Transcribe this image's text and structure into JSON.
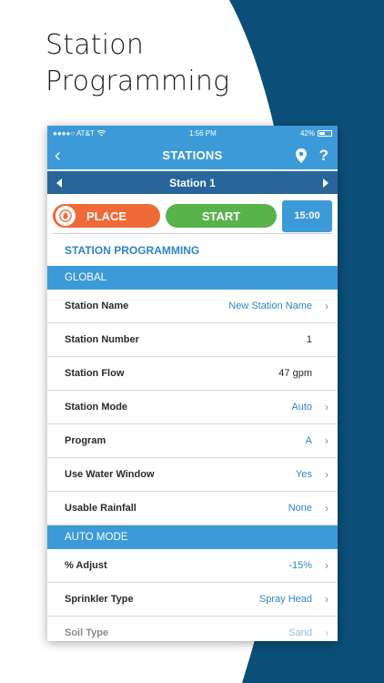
{
  "headline": {
    "line1": "Station",
    "line2": "Programming"
  },
  "status_bar": {
    "carrier": "●●●●○ AT&T",
    "time": "1:56 PM",
    "battery": "42%"
  },
  "nav": {
    "title": "STATIONS",
    "back_icon": "‹",
    "help_icon": "?"
  },
  "station_selector": {
    "label": "Station 1"
  },
  "actions": {
    "place_label": "PLACE",
    "start_label": "START",
    "duration": "15:00"
  },
  "section_title": "STATION PROGRAMMING",
  "global": {
    "header": "GLOBAL",
    "rows": [
      {
        "label": "Station Name",
        "value": "New Station Name",
        "chevron": "›"
      },
      {
        "label": "Station Number",
        "value": "1",
        "chevron": ""
      },
      {
        "label": "Station Flow",
        "value": "47 gpm",
        "chevron": ""
      },
      {
        "label": "Station Mode",
        "value": "Auto",
        "chevron": "›"
      },
      {
        "label": "Program",
        "value": "A",
        "chevron": "›"
      },
      {
        "label": "Use Water Window",
        "value": "Yes",
        "chevron": "›"
      },
      {
        "label": "Usable Rainfall",
        "value": "None",
        "chevron": "›"
      }
    ]
  },
  "auto_mode": {
    "header": "AUTO MODE",
    "rows": [
      {
        "label": "% Adjust",
        "value": "-15%",
        "chevron": "›"
      },
      {
        "label": "Sprinkler Type",
        "value": "Spray Head",
        "chevron": "›"
      },
      {
        "label": "Soil Type",
        "value": "Sand",
        "chevron": "›"
      }
    ]
  },
  "colors": {
    "primary_blue": "#3d9ad8",
    "dark_blue": "#27659a",
    "place_orange": "#ef6a36",
    "start_green": "#5ab24d",
    "background_navy": "#0b4f79"
  }
}
